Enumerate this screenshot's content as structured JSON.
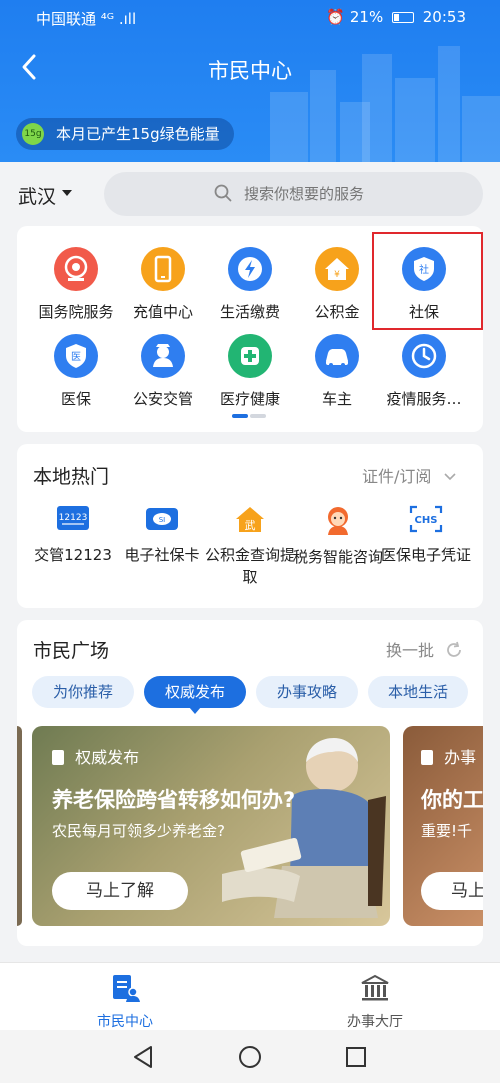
{
  "status": {
    "carrier": "中国联通 ⁴ᴳ .ıll",
    "battery": "21%",
    "time": "20:53"
  },
  "header": {
    "title": "市民中心",
    "energy_badge": "15g",
    "energy_text": "本月已产生15g绿色能量"
  },
  "search": {
    "city": "武汉",
    "placeholder": "搜索你想要的服务"
  },
  "services": [
    {
      "label": "国务院服务",
      "icon": "state-council-icon",
      "color": "#f15a4a"
    },
    {
      "label": "充值中心",
      "icon": "phone-icon",
      "color": "#f7a21b"
    },
    {
      "label": "生活缴费",
      "icon": "lightning-icon",
      "color": "#2f7ef0"
    },
    {
      "label": "公积金",
      "icon": "house-icon",
      "color": "#f7a21b"
    },
    {
      "label": "社保",
      "icon": "shield-icon",
      "color": "#2f7ef0"
    },
    {
      "label": "医保",
      "icon": "shield-icon",
      "color": "#2f7ef0"
    },
    {
      "label": "公安交管",
      "icon": "police-icon",
      "color": "#2f7ef0"
    },
    {
      "label": "医疗健康",
      "icon": "medical-icon",
      "color": "#22b573"
    },
    {
      "label": "车主",
      "icon": "car-icon",
      "color": "#2f7ef0"
    },
    {
      "label": "疫情服务…",
      "icon": "clock-icon",
      "color": "#2f7ef0"
    }
  ],
  "hot": {
    "title": "本地热门",
    "link": "证件/订阅",
    "items": [
      {
        "label": "交管12123",
        "icon": "traffic-12123-icon"
      },
      {
        "label": "电子社保卡",
        "icon": "social-card-icon"
      },
      {
        "label": "公积金查询提取",
        "icon": "housing-fund-icon"
      },
      {
        "label": "税务智能咨询",
        "icon": "tax-assistant-icon"
      },
      {
        "label": "医保电子凭证",
        "icon": "chs-icon"
      }
    ]
  },
  "plaza": {
    "title": "市民广场",
    "refresh": "换一批",
    "tabs": [
      "为你推荐",
      "权威发布",
      "办事攻略",
      "本地生活"
    ],
    "active_tab": "权威发布",
    "banner": {
      "tag": "权威发布",
      "headline": "养老保险跨省转移如何办?",
      "sub": "农民每月可领多少养老金?",
      "button": "马上了解"
    },
    "banner2": {
      "tag": "办事",
      "headline": "你的工",
      "sub": "重要!千",
      "button": "马上"
    }
  },
  "bottom_nav": [
    {
      "label": "市民中心",
      "icon": "citizen-center-icon",
      "active": true
    },
    {
      "label": "办事大厅",
      "icon": "hall-icon",
      "active": false
    }
  ],
  "colors": {
    "accent": "#1d6fe0",
    "highlight_box": "#e0282d"
  }
}
